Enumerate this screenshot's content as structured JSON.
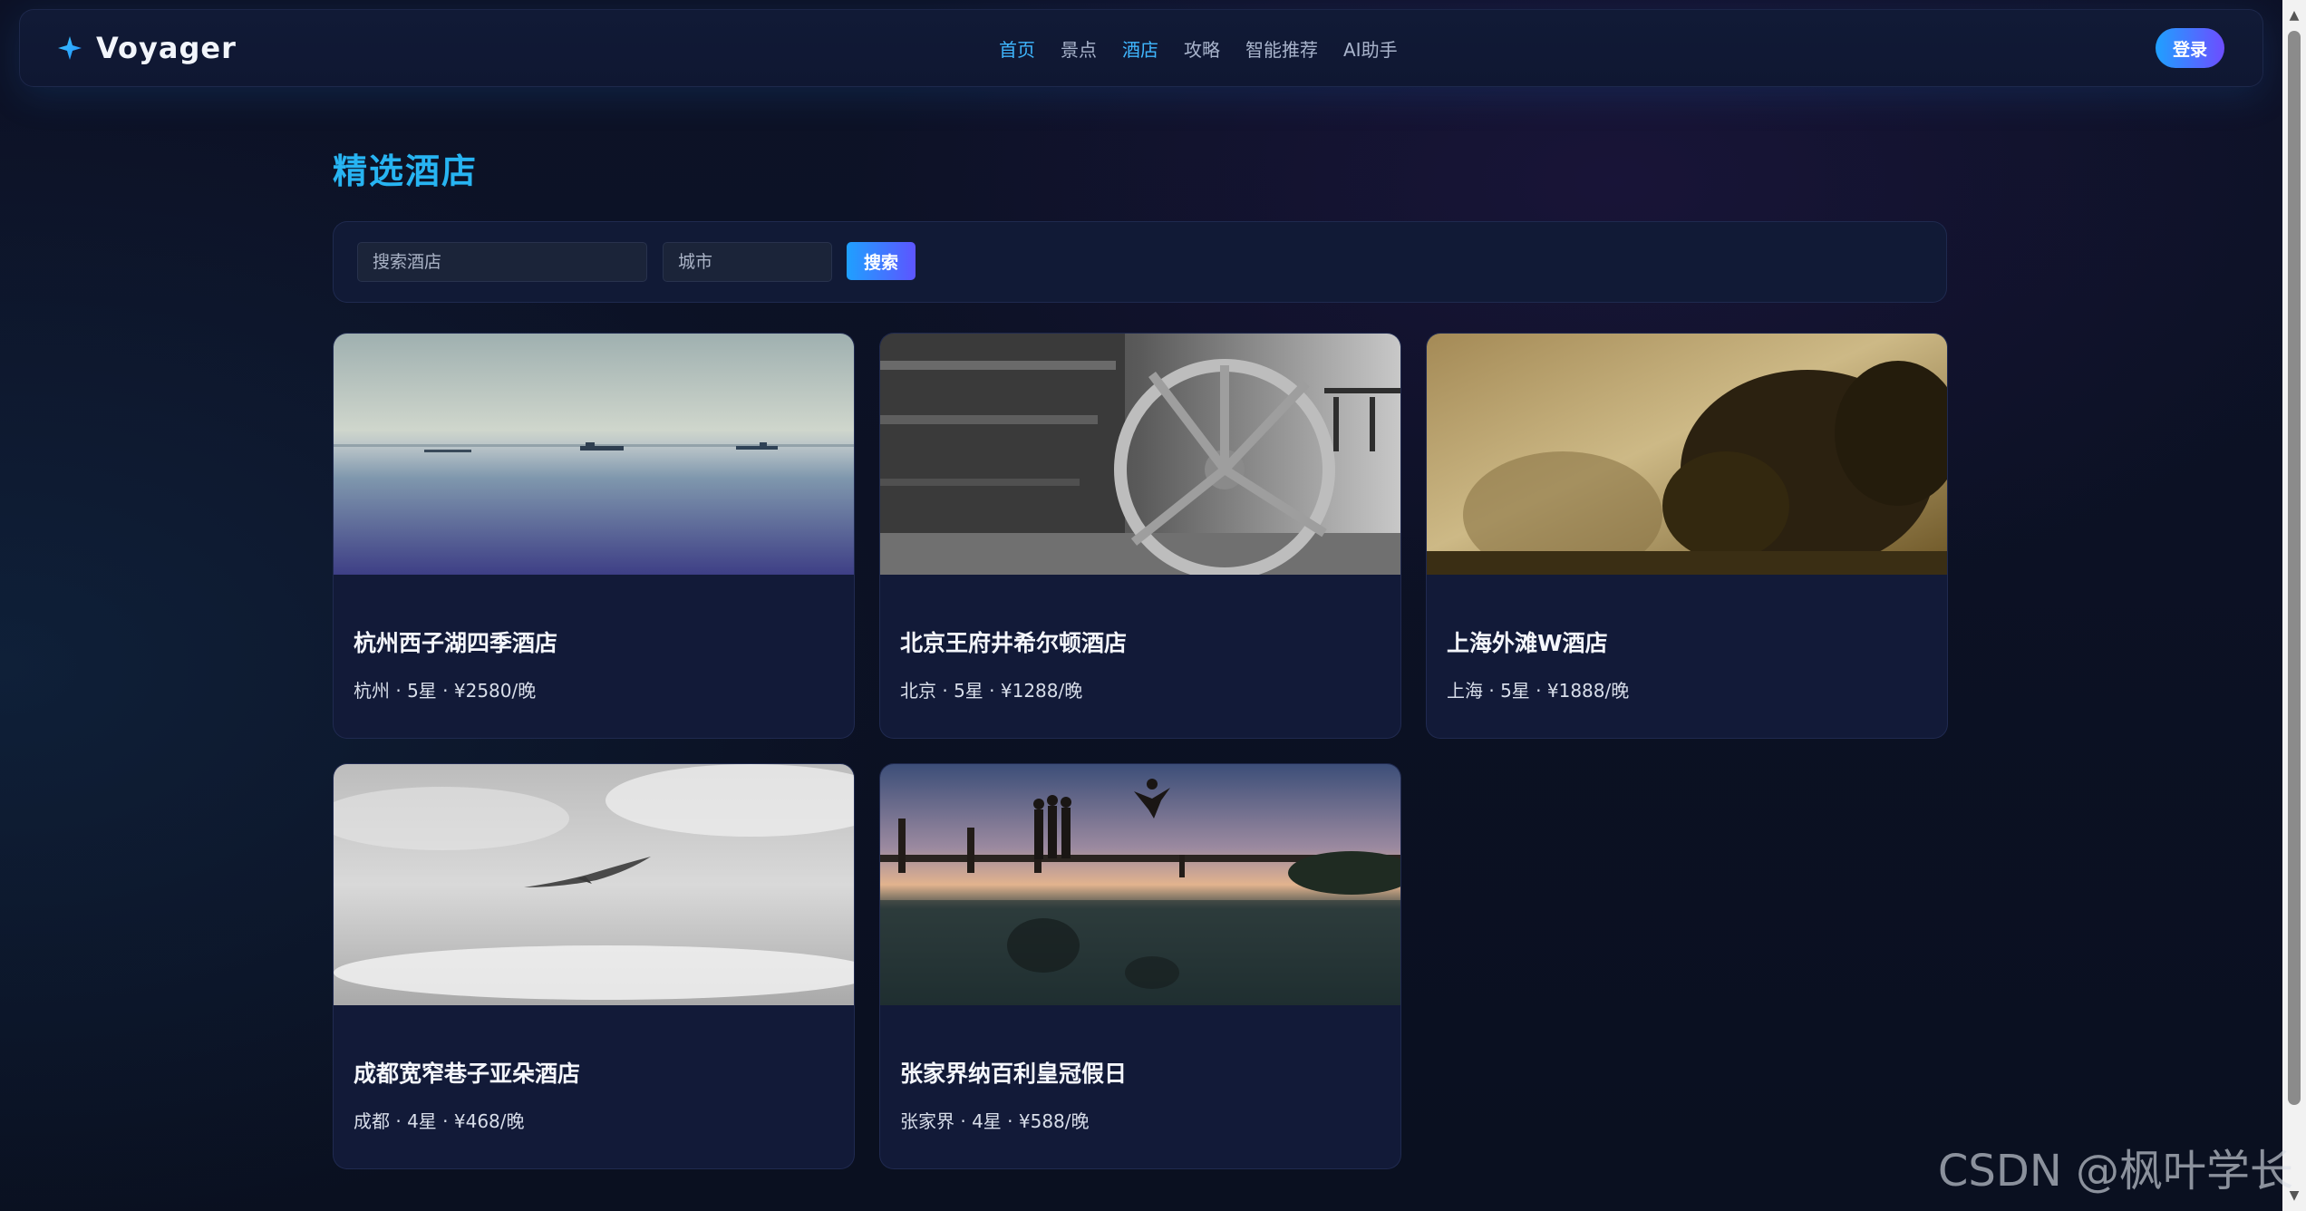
{
  "brand": {
    "name": "Voyager",
    "icon": "sparkle-icon",
    "accent_color": "#27b4f2"
  },
  "nav": {
    "items": [
      {
        "label": "首页",
        "active": true
      },
      {
        "label": "景点",
        "active": false
      },
      {
        "label": "酒店",
        "active": true
      },
      {
        "label": "攻略",
        "active": false
      },
      {
        "label": "智能推荐",
        "active": false
      },
      {
        "label": "AI助手",
        "active": false
      }
    ],
    "login_label": "登录"
  },
  "page": {
    "title": "精选酒店"
  },
  "search": {
    "hotel_placeholder": "搜索酒店",
    "hotel_value": "",
    "city_placeholder": "城市",
    "city_value": "",
    "button_label": "搜索"
  },
  "hotels": [
    {
      "name": "杭州西子湖四季酒店",
      "meta": "杭州 · 5星 · ¥2580/晚"
    },
    {
      "name": "北京王府井希尔顿酒店",
      "meta": "北京 · 5星 · ¥1288/晚"
    },
    {
      "name": "上海外滩W酒店",
      "meta": "上海 · 5星 · ¥1888/晚"
    },
    {
      "name": "成都宽窄巷子亚朵酒店",
      "meta": "成都 · 4星 · ¥468/晚"
    },
    {
      "name": "张家界纳百利皇冠假日",
      "meta": "张家界 · 4星 · ¥588/晚"
    }
  ],
  "watermark": "CSDN @枫叶学长"
}
